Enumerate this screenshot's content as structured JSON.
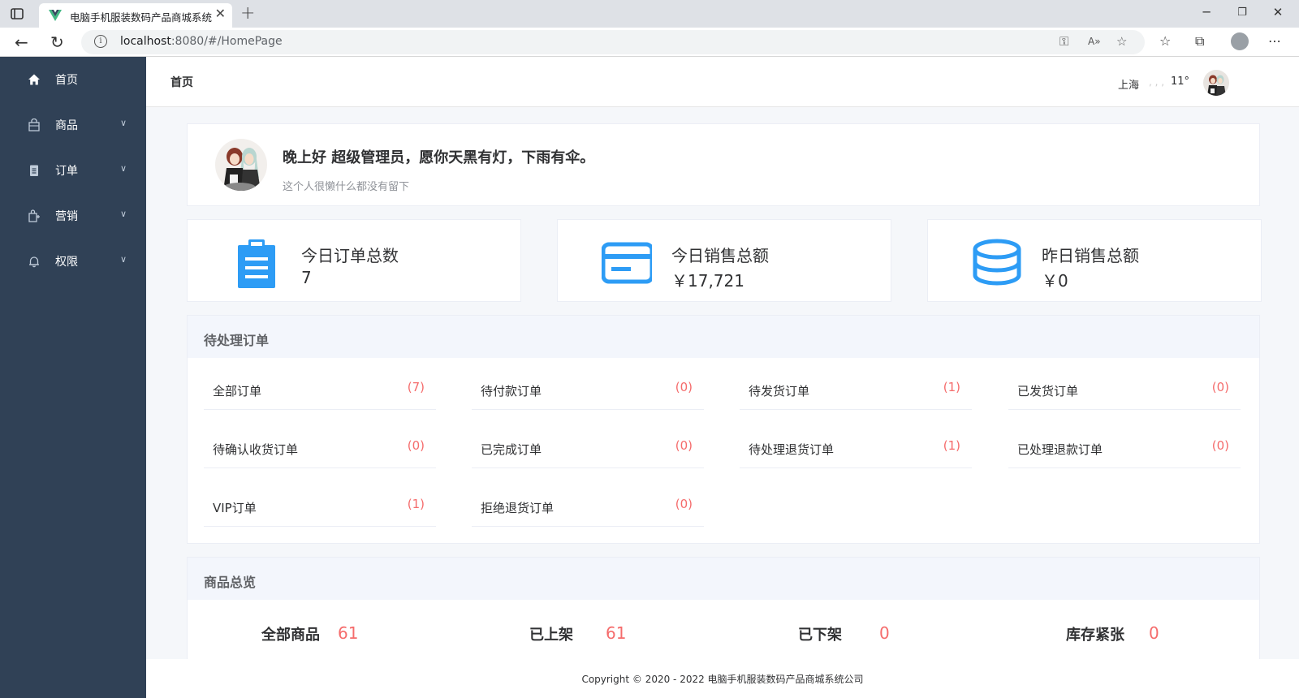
{
  "browser": {
    "tab_title": "电脑手机服装数码产品商城系统",
    "url_host": "localhost",
    "url_rest": ":8080/#/HomePage"
  },
  "sidebar": {
    "items": [
      {
        "label": "首页",
        "icon": "home-icon"
      },
      {
        "label": "商品",
        "icon": "goods-bag-icon"
      },
      {
        "label": "订单",
        "icon": "order-list-icon"
      },
      {
        "label": "营销",
        "icon": "marketing-icon"
      },
      {
        "label": "权限",
        "icon": "bell-icon"
      }
    ],
    "bg_color": "#304156"
  },
  "header": {
    "title": "首页",
    "city": "上海",
    "temperature": "11°"
  },
  "welcome": {
    "title": "晚上好 超级管理员，愿你天黑有灯，下雨有伞。",
    "subtitle": "这个人很懒什么都没有留下"
  },
  "stats": [
    {
      "label": "今日订单总数",
      "value": "7",
      "icon": "clipboard-icon"
    },
    {
      "label": "今日销售总额",
      "value": "￥17,721",
      "icon": "credit-card-icon"
    },
    {
      "label": "昨日销售总额",
      "value": "￥0",
      "icon": "coin-stack-icon"
    }
  ],
  "accent_color": "#2d9cf5",
  "orders": {
    "title": "待处理订单",
    "items": [
      {
        "name": "全部订单",
        "count": "(7)"
      },
      {
        "name": "待付款订单",
        "count": "(0)"
      },
      {
        "name": "待发货订单",
        "count": "(1)"
      },
      {
        "name": "已发货订单",
        "count": "(0)"
      },
      {
        "name": "待确认收货订单",
        "count": "(0)"
      },
      {
        "name": "已完成订单",
        "count": "(0)"
      },
      {
        "name": "待处理退货订单",
        "count": "(1)"
      },
      {
        "name": "已处理退款订单",
        "count": "(0)"
      },
      {
        "name": "VIP订单",
        "count": "(1)"
      },
      {
        "name": "拒绝退货订单",
        "count": "(0)"
      }
    ]
  },
  "goods": {
    "title": "商品总览",
    "items": [
      {
        "label": "全部商品",
        "value": "61"
      },
      {
        "label": "已上架",
        "value": "61"
      },
      {
        "label": "已下架",
        "value": "0"
      },
      {
        "label": "库存紧张",
        "value": "0"
      }
    ]
  },
  "footer": {
    "copyright": "Copyright © 2020 - 2022   电脑手机服装数码产品商城系统公司"
  }
}
